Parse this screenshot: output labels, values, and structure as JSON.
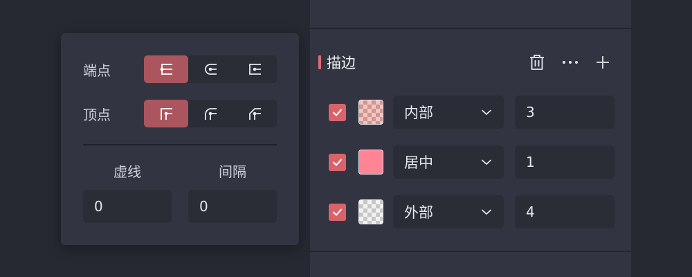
{
  "line_style": {
    "cap": {
      "label": "端点",
      "options": [
        {
          "icon": "butt-cap-icon",
          "selected": true
        },
        {
          "icon": "round-cap-icon",
          "selected": false
        },
        {
          "icon": "square-cap-icon",
          "selected": false
        }
      ]
    },
    "join": {
      "label": "顶点",
      "options": [
        {
          "icon": "miter-join-icon",
          "selected": true
        },
        {
          "icon": "round-join-icon",
          "selected": false
        },
        {
          "icon": "bevel-join-icon",
          "selected": false
        }
      ]
    },
    "dash": {
      "label": "虚线",
      "value": "0"
    },
    "gap": {
      "label": "间隔",
      "value": "0"
    }
  },
  "stroke_section": {
    "title": "描边",
    "actions": [
      "trash-icon",
      "more-icon",
      "add-icon"
    ],
    "rows": [
      {
        "checked": true,
        "swatch": "checker-red",
        "position": "内部",
        "width": "3"
      },
      {
        "checked": true,
        "swatch": "solid-pink",
        "position": "居中",
        "width": "1"
      },
      {
        "checked": true,
        "swatch": "checker-gray",
        "position": "外部",
        "width": "4"
      }
    ]
  },
  "colors": {
    "background": "#262932",
    "panel": "#323541",
    "field": "#2a2d36",
    "accent": "#ab565e",
    "checkbox": "#d9636b",
    "section_marker": "#e06b73",
    "swatch_solid": "#ff8596"
  }
}
